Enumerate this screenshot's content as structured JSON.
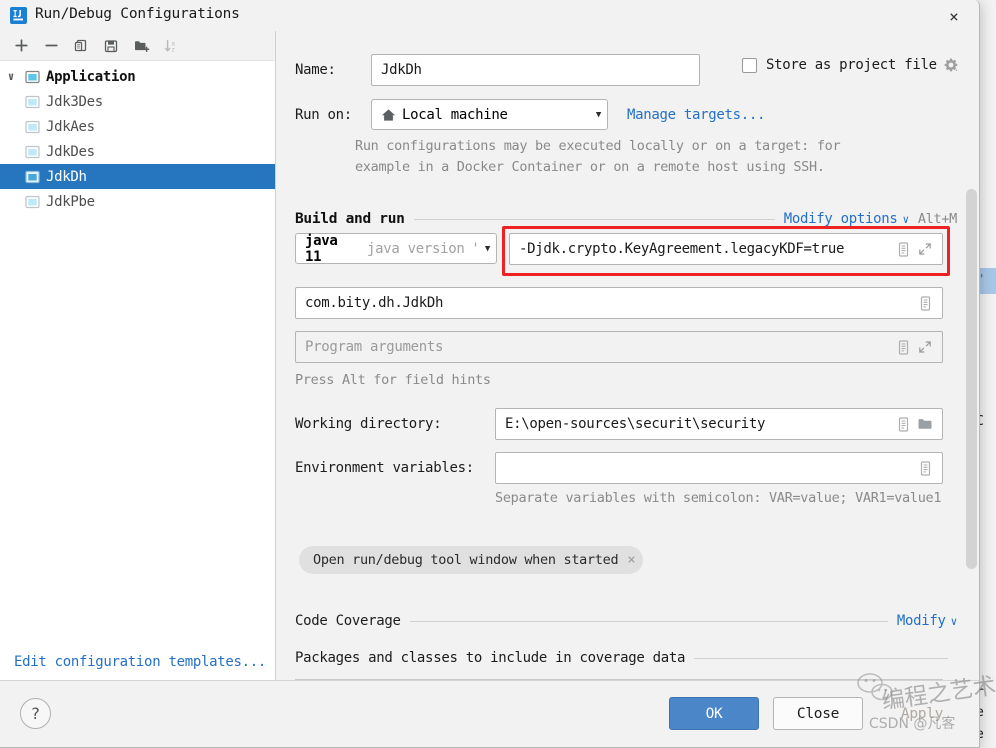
{
  "window": {
    "title": "Run/Debug Configurations",
    "app_icon": "intellij-idea-icon",
    "close_label": "×"
  },
  "toolbar": {
    "items": [
      {
        "name": "add-configuration-button",
        "icon": "plus-icon",
        "label": "+"
      },
      {
        "name": "remove-configuration-button",
        "icon": "minus-icon",
        "label": "−"
      },
      {
        "name": "copy-configuration-button",
        "icon": "copy-icon",
        "label": "Copy"
      },
      {
        "name": "save-configuration-button",
        "icon": "save-icon",
        "label": "Save"
      },
      {
        "name": "move-to-folder-button",
        "icon": "new-folder-icon",
        "label": "New Folder"
      },
      {
        "name": "sort-configurations-button",
        "icon": "sort-az-icon",
        "label": "Sort"
      }
    ]
  },
  "tree": {
    "group": {
      "label": "Application",
      "icon": "application-icon",
      "expanded": true,
      "twisty": "∨"
    },
    "children": [
      {
        "label": "Jdk3Des",
        "selected": false
      },
      {
        "label": "JdkAes",
        "selected": false
      },
      {
        "label": "JdkDes",
        "selected": false
      },
      {
        "label": "JdkDh",
        "selected": true
      },
      {
        "label": "JdkPbe",
        "selected": false
      }
    ],
    "selection_color": "#2675bf"
  },
  "edit_templates": {
    "label": "Edit configuration templates..."
  },
  "form": {
    "name_label": "Name:",
    "name_value": "JdkDh",
    "store_as_project_file": {
      "label": "Store as project file",
      "checked": false,
      "gear_icon": "gear-icon"
    },
    "run_on_label": "Run on:",
    "run_on_value": "Local machine",
    "run_on_icon": "home-icon",
    "manage_targets_link": "Manage targets...",
    "run_on_hint_line1": "Run configurations may be executed locally or on a target: for",
    "run_on_hint_line2": "example in a Docker Container or on a remote host using SSH."
  },
  "build_and_run": {
    "section_title": "Build and run",
    "modify_options_link": "Modify options",
    "modify_options_caret": "∨",
    "modify_options_shortcut": "Alt+M",
    "jre_bold": "java 11",
    "jre_grey": "java version \"",
    "jre_caret": "▼",
    "vm_options_value": "-Djdk.crypto.KeyAgreement.legacyKDF=true",
    "vm_options_expand_icon": "expand-icon",
    "vm_options_macro_icon": "macro-icon",
    "main_class_value": "com.bity.dh.JdkDh",
    "main_class_macro_icon": "macro-icon",
    "program_arguments_placeholder": "Program arguments",
    "field_hints": "Press Alt for field hints",
    "working_directory_label": "Working directory:",
    "working_directory_value": "E:\\open-sources\\securit\\security",
    "working_directory_browse_icon": "folder-icon",
    "environment_variables_label": "Environment variables:",
    "environment_variables_value": "",
    "environment_variables_hint": "Separate variables with semicolon: VAR=value; VAR1=value1",
    "chip": {
      "label": "Open run/debug tool window when started",
      "remove_icon": "close-icon",
      "remove_label": "×"
    },
    "highlight_color": "#ee2222"
  },
  "code_coverage": {
    "section_title": "Code Coverage",
    "modify_link": "Modify",
    "modify_caret": "∨",
    "packages_label": "Packages and classes to include in coverage data"
  },
  "footer": {
    "help_label": "?",
    "help_icon": "help-icon",
    "ok_label": "OK",
    "close_label": "Close",
    "apply_label": "Apply",
    "apply_enabled": false,
    "ok_color": "#4a86c8"
  },
  "watermark": {
    "cn_text": "编程之艺术",
    "credit_text": "CSDN @凡客",
    "logo_icon": "wechat-logo-icon"
  },
  "backdrop": {
    "ghost_chars": [
      "\"",
      "C",
      "r",
      "e",
      "e"
    ]
  }
}
